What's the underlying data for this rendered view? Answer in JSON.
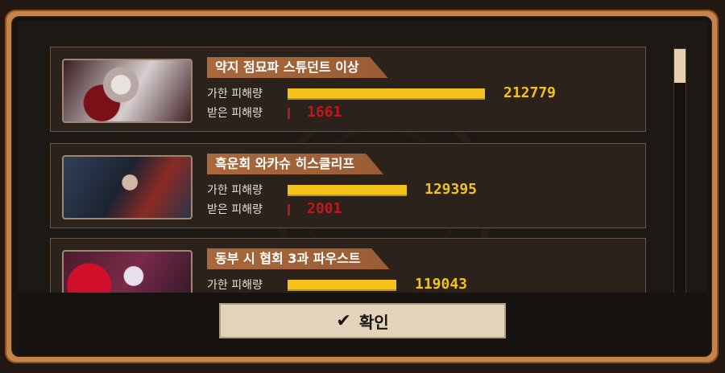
{
  "players": [
    {
      "name": "약지 점묘파 스튜던트 이상",
      "dealt_label": "가한 피해량",
      "dealt": "212779",
      "dealt_fraction": 0.98,
      "taken_label": "받은 피해량",
      "taken": "1661"
    },
    {
      "name": "흑운회 와카슈 히스클리프",
      "dealt_label": "가한 피해량",
      "dealt": "129395",
      "dealt_fraction": 0.59,
      "taken_label": "받은 피해량",
      "taken": "2001"
    },
    {
      "name": "동부 시 협회 3과 파우스트",
      "dealt_label": "가한 피해량",
      "dealt": "119043",
      "dealt_fraction": 0.54
    }
  ],
  "confirm_label": "확인",
  "icons": {
    "confirm": "check-icon"
  },
  "colors": {
    "bar": "#f4c21a",
    "taken_value": "#c3161b",
    "frame": "#c6844a",
    "name_tag": "#a8683c"
  }
}
